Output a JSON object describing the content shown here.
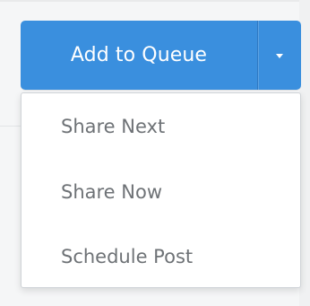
{
  "button": {
    "primary_label": "Add to Queue",
    "toggle_icon": "caret-down-icon"
  },
  "menu": {
    "items": [
      {
        "label": "Share Next"
      },
      {
        "label": "Share Now"
      },
      {
        "label": "Schedule Post"
      }
    ]
  },
  "colors": {
    "primary": "#3a8fde",
    "menu_text": "#6e7276",
    "menu_background": "#ffffff"
  }
}
